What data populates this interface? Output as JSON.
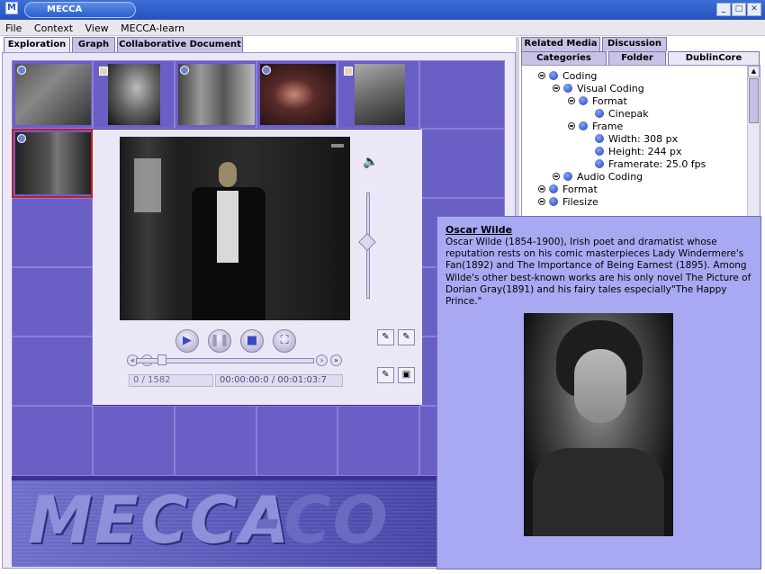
{
  "window": {
    "title": "MECCA",
    "app_icon": "M",
    "buttons": [
      "_",
      "□",
      "✕"
    ]
  },
  "menu": [
    "File",
    "Context",
    "View",
    "MECCA-learn"
  ],
  "left_tabs": [
    "Exploration",
    "Graph",
    "Collaborative Document"
  ],
  "player": {
    "frame_counter": "0 / 1582",
    "time_display": "00:00:00:0 / 00:01:03:7"
  },
  "banner": {
    "logo_text": "MECCA",
    "logo_text_2": "-CO"
  },
  "right_tabs_top": [
    "Related Media",
    "Discussion"
  ],
  "right_tabs_bottom": [
    "Categories",
    "Folder",
    "DublinCore"
  ],
  "tree": [
    {
      "label": "Coding"
    },
    {
      "label": "Visual Coding"
    },
    {
      "label": "Format"
    },
    {
      "label": "Cinepak"
    },
    {
      "label": "Frame"
    },
    {
      "label": "Width: 308 px"
    },
    {
      "label": "Height: 244 px"
    },
    {
      "label": "Framerate: 25.0 fps"
    },
    {
      "label": "Audio Coding"
    },
    {
      "label": "Format"
    },
    {
      "label": "Filesize"
    }
  ],
  "popup": {
    "title": "Oscar Wilde",
    "body": "Oscar Wilde (1854-1900), Irish poet and dramatist whose reputation rests on his comic masterpieces Lady Windermere's Fan(1892) and The Importance of Being Earnest (1895). Among Wilde's other best-known works are his only novel The Picture of Dorian Gray(1891) and his fairy tales especially\"The Happy Prince.\""
  },
  "colors": {
    "accent": "#3d6fd6",
    "grid_cell": "#6a5fc4",
    "popup_bg": "#a9a9f3",
    "selected_border": "#c0202a"
  }
}
